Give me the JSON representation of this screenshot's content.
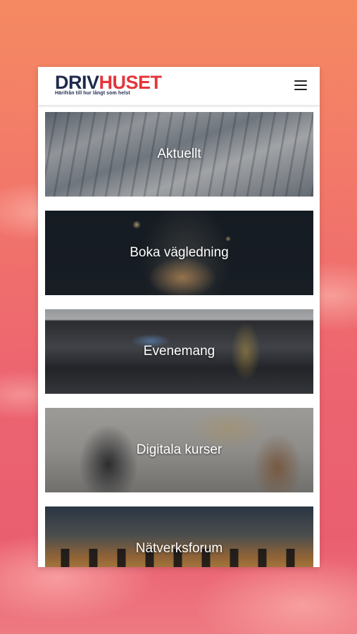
{
  "header": {
    "logo": {
      "part1": "DRIV",
      "part2": "HUSET",
      "tagline": "Härifrån till hur långt som helst"
    },
    "menu_icon": "hamburger-menu-icon"
  },
  "tiles": [
    {
      "label": "Aktuellt"
    },
    {
      "label": "Boka vägledning"
    },
    {
      "label": "Evenemang"
    },
    {
      "label": "Digitala kurser"
    },
    {
      "label": "Nätverksforum"
    }
  ],
  "colors": {
    "brand_dark": "#1f2a4d",
    "brand_red": "#e4363a",
    "background_top": "#f58a62",
    "background_bottom": "#ea5f70"
  }
}
